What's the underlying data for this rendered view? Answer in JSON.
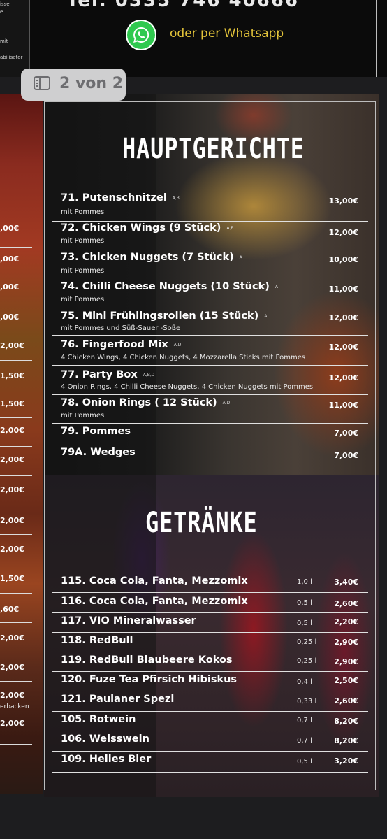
{
  "top": {
    "left_fragments": [
      "isse",
      "e",
      "mit",
      "abilisator"
    ],
    "phone_partial": "Tel. 0335 746 40666",
    "whatsapp_text": "oder per Whatsapp"
  },
  "page_indicator": {
    "text": "2 von 2"
  },
  "left_prices": [
    {
      "text": ",00€"
    },
    {
      "text": ",00€"
    },
    {
      "text": ",00€"
    },
    {
      "text": ",00€"
    },
    {
      "text": "2,00€"
    },
    {
      "text": "1,50€"
    },
    {
      "text": "1,50€"
    },
    {
      "text": "2,00€"
    },
    {
      "text": "2,00€"
    },
    {
      "text": "2,00€"
    },
    {
      "text": "2,00€"
    },
    {
      "text": "2,00€"
    },
    {
      "text": "1,50€"
    },
    {
      "text": ",60€"
    },
    {
      "text": "2,00€"
    },
    {
      "text": "2,00€"
    },
    {
      "text": "2,00€"
    },
    {
      "text": "2,00€"
    }
  ],
  "left_sub": "erbacken",
  "hauptgerichte": {
    "title": "HAUPTGERICHTE",
    "items": [
      {
        "name": "71. Putenschnitzel",
        "allergen": "A,B",
        "sub": "mit Pommes",
        "price": "13,00€"
      },
      {
        "name": "72. Chicken Wings (9 Stück)",
        "allergen": "A,B",
        "sub": "mit Pommes",
        "price": "12,00€"
      },
      {
        "name": "73. Chicken Nuggets (7 Stück)",
        "allergen": "A",
        "sub": "mit Pommes",
        "price": "10,00€"
      },
      {
        "name": "74. Chilli Cheese Nuggets (10 Stück)",
        "allergen": "A",
        "sub": "mit Pommes",
        "price": "11,00€"
      },
      {
        "name": "75. Mini Frühlingsrollen (15 Stück)",
        "allergen": "A",
        "sub": "mit Pommes und Süß-Sauer -Soße",
        "price": "12,00€"
      },
      {
        "name": "76. Fingerfood Mix",
        "allergen": "A,D",
        "sub": "4 Chicken Wings, 4 Chicken Nuggets, 4 Mozzarella Sticks mit Pommes",
        "price": "12,00€"
      },
      {
        "name": "77. Party Box",
        "allergen": "A,B,D",
        "sub": "4 Onion Rings, 4 Chilli Cheese Nuggets, 4 Chicken Nuggets mit Pommes",
        "price": "12,00€"
      },
      {
        "name": "78. Onion Rings ( 12 Stück)",
        "allergen": "A,D",
        "sub": "mit Pommes",
        "price": "11,00€"
      },
      {
        "name": "79. Pommes",
        "allergen": "",
        "sub": "",
        "price": "7,00€"
      },
      {
        "name": "79A. Wedges",
        "allergen": "",
        "sub": "",
        "price": "7,00€"
      }
    ]
  },
  "getraenke": {
    "title": "GETRÄNKE",
    "items": [
      {
        "name": "115. Coca Cola, Fanta, Mezzomix",
        "volume": "1,0 l",
        "price": "3,40€"
      },
      {
        "name": "116. Coca Cola, Fanta, Mezzomix",
        "volume": "0,5 l",
        "price": "2,60€"
      },
      {
        "name": "117. VIO Mineralwasser",
        "volume": "0,5 l",
        "price": "2,20€"
      },
      {
        "name": "118. RedBull",
        "volume": "0,25 l",
        "price": "2,90€"
      },
      {
        "name": "119. RedBull Blaubeere Kokos",
        "volume": "0,25 l",
        "price": "2,90€"
      },
      {
        "name": "120. Fuze Tea Pfirsich Hibiskus",
        "volume": "0,4 l",
        "price": "2,50€"
      },
      {
        "name": "121. Paulaner Spezi",
        "volume": "0,33 l",
        "price": "2,60€"
      },
      {
        "name": "105. Rotwein",
        "volume": "0,7 l",
        "price": "8,20€"
      },
      {
        "name": "106. Weisswein",
        "volume": "0,7 l",
        "price": "8,20€"
      },
      {
        "name": "109. Helles Bier",
        "volume": "0,5 l",
        "price": "3,20€"
      }
    ]
  },
  "colors": {
    "whatsapp_green": "#2fc94f",
    "whatsapp_text": "#e3c43a",
    "badge_bg": "#cfcfd0",
    "badge_fg": "#6d6d70"
  },
  "icons": {
    "whatsapp": "whatsapp-icon",
    "page": "sidebar-page-icon"
  }
}
